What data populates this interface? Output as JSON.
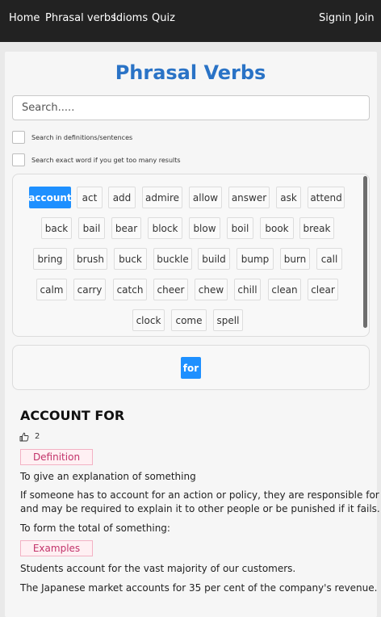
{
  "nav": {
    "home": "Home",
    "phrasal_verbs": "Phrasal verbs",
    "idioms": "Idioms",
    "quiz": "Quiz",
    "signin": "Signin",
    "join": "Join"
  },
  "title": "Phrasal Verbs",
  "search": {
    "placeholder": "Search.....",
    "value": "",
    "option_definitions": "Search in definitions/sentences",
    "option_exact": "Search exact word if you get too many results"
  },
  "verbs": [
    "account",
    "act",
    "add",
    "admire",
    "allow",
    "answer",
    "ask",
    "attend",
    "back",
    "bail",
    "bear",
    "block",
    "blow",
    "boil",
    "book",
    "break",
    "bring",
    "brush",
    "buck",
    "buckle",
    "build",
    "bump",
    "burn",
    "call",
    "calm",
    "carry",
    "catch",
    "cheer",
    "chew",
    "chill",
    "clean",
    "clear",
    "clock",
    "come",
    "spell"
  ],
  "selected_verb": "account",
  "particles": [
    "for"
  ],
  "selected_particle": "for",
  "entry": {
    "title": "ACCOUNT FOR",
    "likes": "2",
    "definition_label": "Definition",
    "definition_1": "To give an explanation of something",
    "definition_1_detail_1": "If someone has to account for an action or policy, they are responsible for it,",
    "definition_1_detail_2": "and may be required to explain it to other people or be punished if it fails.",
    "definition_2": "To form the total of something:",
    "examples_label": "Examples",
    "example_1": "Students account for the vast majority of our customers.",
    "example_2": "The Japanese market accounts for 35 per cent of the company's revenue."
  },
  "colors": {
    "navbar": "#222222",
    "title": "#2a73c6",
    "active_chip": "#1e90ff",
    "tag_text": "#c2336a",
    "tag_border": "#f3b2c4",
    "tag_bg": "#fff0f3"
  },
  "icons": {
    "like": "thumbs-up-icon"
  }
}
